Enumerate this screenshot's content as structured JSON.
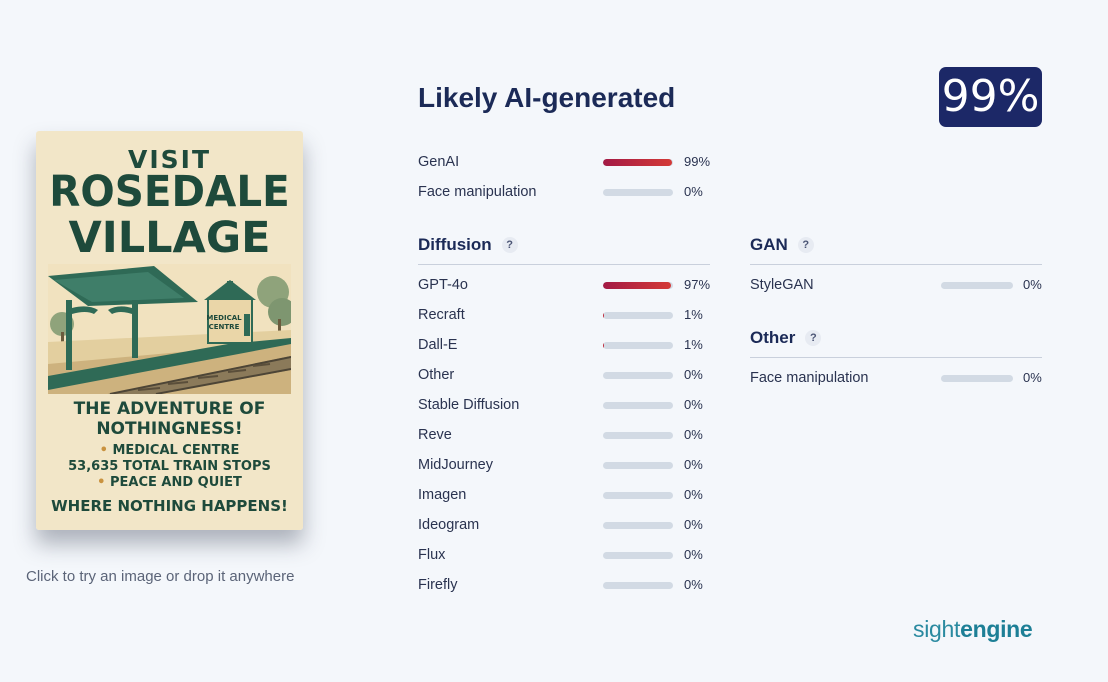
{
  "poster": {
    "visit": "VISIT",
    "name_line1": "ROSEDALE",
    "name_line2": "VILLAGE",
    "sign_line1": "MEDICAL",
    "sign_line2": "CENTRE",
    "tagline_line1": "THE ADVENTURE OF",
    "tagline_line2": "NOTHINGNESS!",
    "bullets": [
      "MEDICAL CENTRE",
      "53,635 TOTAL TRAIN STOPS",
      "PEACE AND QUIET"
    ],
    "footer": "WHERE NOTHING HAPPENS!"
  },
  "upload_hint": "Click to try an image or drop it anywhere",
  "result": {
    "title": "Likely AI-generated",
    "score": "99%"
  },
  "summary": [
    {
      "label": "GenAI",
      "value": 0.99,
      "pct": "99%"
    },
    {
      "label": "Face manipulation",
      "value": 0.0,
      "pct": "0%"
    }
  ],
  "diffusion": {
    "heading": "Diffusion",
    "help": "?",
    "items": [
      {
        "label": "GPT-4o",
        "value": 0.97,
        "pct": "97%"
      },
      {
        "label": "Recraft",
        "value": 0.01,
        "pct": "1%"
      },
      {
        "label": "Dall-E",
        "value": 0.01,
        "pct": "1%"
      },
      {
        "label": "Other",
        "value": 0.0,
        "pct": "0%"
      },
      {
        "label": "Stable Diffusion",
        "value": 0.0,
        "pct": "0%"
      },
      {
        "label": "Reve",
        "value": 0.0,
        "pct": "0%"
      },
      {
        "label": "MidJourney",
        "value": 0.0,
        "pct": "0%"
      },
      {
        "label": "Imagen",
        "value": 0.0,
        "pct": "0%"
      },
      {
        "label": "Ideogram",
        "value": 0.0,
        "pct": "0%"
      },
      {
        "label": "Flux",
        "value": 0.0,
        "pct": "0%"
      },
      {
        "label": "Firefly",
        "value": 0.0,
        "pct": "0%"
      }
    ]
  },
  "gan": {
    "heading": "GAN",
    "help": "?",
    "items": [
      {
        "label": "StyleGAN",
        "value": 0.0,
        "pct": "0%"
      }
    ]
  },
  "other": {
    "heading": "Other",
    "help": "?",
    "items": [
      {
        "label": "Face manipulation",
        "value": 0.0,
        "pct": "0%"
      }
    ]
  },
  "brand": {
    "light": "sight",
    "bold": "engine"
  },
  "colors": {
    "accent_navy": "#1c2867",
    "bar_fill_start": "#a31a45",
    "bar_fill_end": "#d43a37",
    "bar_track": "#d2dae4",
    "brand_teal": "#1d7f96"
  }
}
